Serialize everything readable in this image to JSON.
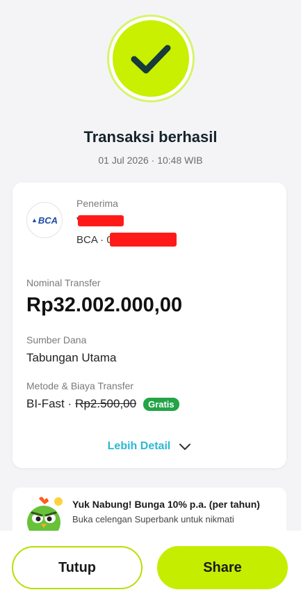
{
  "status": {
    "icon": "checkmark-icon",
    "accent_color": "#c8f000"
  },
  "title": "Transaksi berhasil",
  "datetime": "01 Jul 2026 · 10:48 WIB",
  "recipient": {
    "label": "Penerima",
    "name_prefix": "V",
    "bank_prefix": "BCA · 0",
    "logo_text": "BCA",
    "logo_icon": "bca-logo-icon"
  },
  "nominal": {
    "label": "Nominal Transfer",
    "value": "Rp32.002.000,00"
  },
  "source": {
    "label": "Sumber Dana",
    "value": "Tabungan Utama"
  },
  "method": {
    "label": "Metode & Biaya Transfer",
    "name": "BI-Fast ·",
    "fee": "Rp2.500,00",
    "badge": "Gratis",
    "badge_color": "#22a447"
  },
  "detail_link": "Lebih Detail",
  "promo": {
    "title": "Yuk Nabung! Bunga 10% p.a. (per tahun)",
    "text": "Buka celengan Superbank untuk nikmati",
    "mascot_icon": "owl-mascot-icon"
  },
  "buttons": {
    "close": "Tutup",
    "share": "Share",
    "share_color": "#c5ed00"
  }
}
